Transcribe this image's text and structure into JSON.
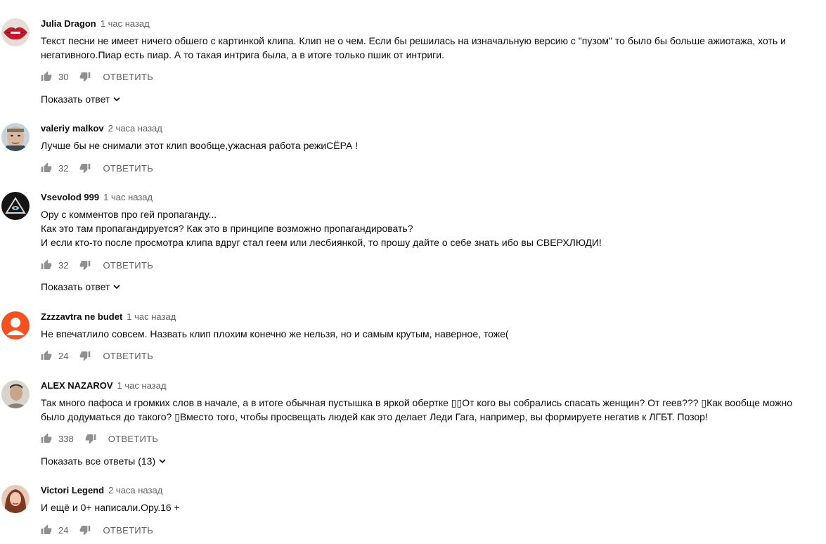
{
  "comments": [
    {
      "author": "Julia Dragon",
      "time": "1 час назад",
      "text": "Текст песни не имеет ничего обшего с картинкой клипа. Клип не о чем. Если бы решилась на изначальную версию с \"пузом\" то было бы больше ажиотажа, хоть и\nнегативного.Пиар есть пиар. А то такая интрига была, а в итоге только пшик от интриги.",
      "likes": "30",
      "reply_label": "ОТВЕТИТЬ",
      "show_replies": "Показать ответ",
      "avatar_icon": "lips-avatar"
    },
    {
      "author": "valeriy malkov",
      "time": "2 часа назад",
      "text": "Лучше бы не снимали этот клип вообще,ужасная работа режиСЁРА !",
      "likes": "32",
      "reply_label": "ОТВЕТИТЬ",
      "avatar_icon": "face-avatar"
    },
    {
      "author": "Vsevolod 999",
      "time": "1 час назад",
      "text": "Ору с комментов про гей пропаганду...\nКак это там пропагандируется? Как это в принципе возможно пропагандировать?\nИ если кто-то после просмотра клипа вдруг стал геем или лесбиянкой, то прошу дайте о себе знать ибо вы СВЕРХЛЮДИ!",
      "likes": "32",
      "reply_label": "ОТВЕТИТЬ",
      "show_replies": "Показать ответ",
      "avatar_icon": "triangle-eye-avatar"
    },
    {
      "author": "Zzzzavtra ne budet",
      "time": "1 час назад",
      "text": "Не впечатлило совсем. Назвать клип плохим конечно же нельзя, но и самым крутым, наверное, тоже(",
      "likes": "24",
      "reply_label": "ОТВЕТИТЬ",
      "avatar_icon": "default-user-avatar"
    },
    {
      "author": "ALEX NAZAROV",
      "time": "1 час назад",
      "text": "Так много пафоса и громких слов в начале, а в итоге обычная пустышка в яркой обертке ▯▯От кого вы собрались спасать женщин? От геев??? ▯Как вообще можно\nбыло додуматься до такого? ▯Вместо того, чтобы просвещать людей как это делает Леди Гага, например, вы формируете негатив к ЛГБТ. Позор!",
      "likes": "338",
      "reply_label": "ОТВЕТИТЬ",
      "show_replies": "Показать все ответы (13)",
      "avatar_icon": "man-photo-avatar"
    },
    {
      "author": "Victori Legend",
      "time": "2 часа назад",
      "text": "И ещё и 0+ написали.Ору.16 +",
      "likes": "24",
      "reply_label": "ОТВЕТИТЬ",
      "avatar_icon": "woman-photo-avatar"
    }
  ]
}
